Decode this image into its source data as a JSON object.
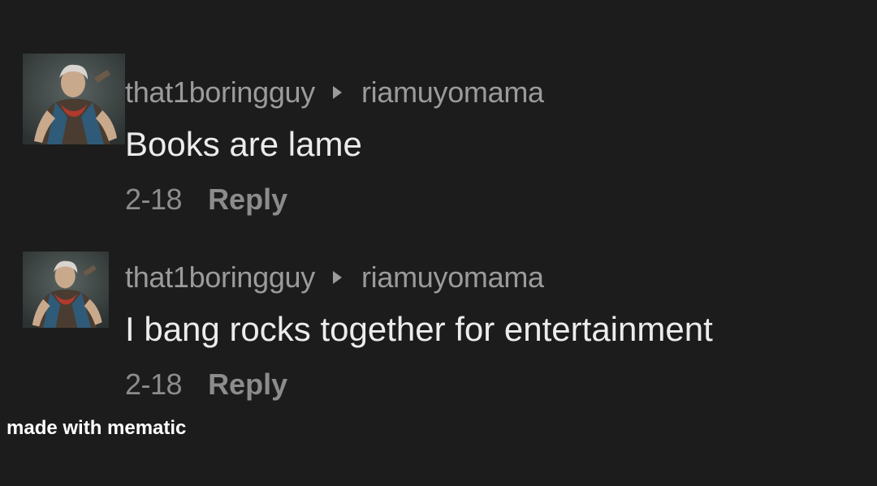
{
  "comments": [
    {
      "username": "that1boringguy",
      "reply_to": "riamuyomama",
      "text": "Books are lame",
      "date": "2-18",
      "reply_label": "Reply"
    },
    {
      "username": "that1boringguy",
      "reply_to": "riamuyomama",
      "text": "I bang rocks together for entertainment",
      "date": "2-18",
      "reply_label": "Reply"
    }
  ],
  "watermark": "made with mematic",
  "colors": {
    "background": "#1c1c1c",
    "username": "#9b9b9b",
    "comment_text": "#ececec",
    "meta_text": "#8c8c8c",
    "watermark": "#ffffff"
  },
  "icons": [
    "avatar",
    "reply-arrow-icon"
  ]
}
